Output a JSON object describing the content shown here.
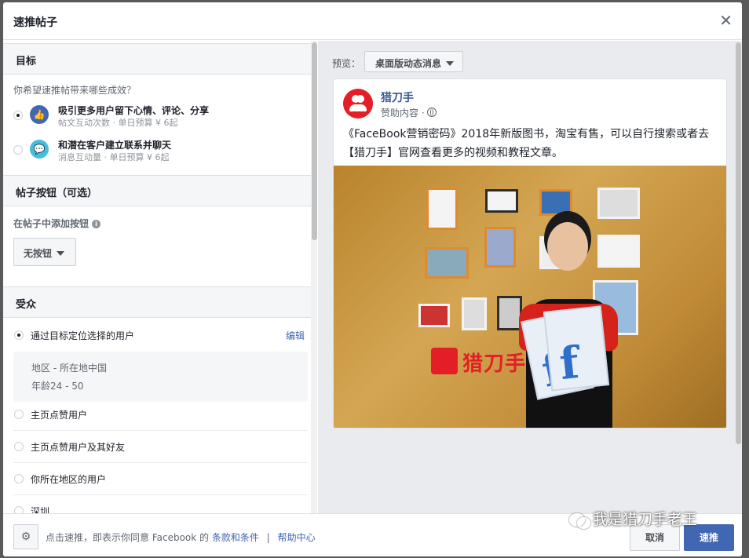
{
  "dialog": {
    "title": "速推帖子"
  },
  "sections": {
    "goal": "目标",
    "post_button": "帖子按钮（可选）",
    "audience": "受众"
  },
  "goal": {
    "question": "你希望速推帖带来哪些成效？",
    "options": [
      {
        "title": "吸引更多用户留下心情、评论、分享",
        "sub": "帖文互动次数 · 单日预算 ¥ 6起",
        "icon": "thumbs-up-icon",
        "color": "#4267b2",
        "selected": true
      },
      {
        "title": "和潜在客户建立联系并聊天",
        "sub": "消息互动量 · 单日预算 ¥ 6起",
        "icon": "chat-bubble-icon",
        "color": "#45bde0",
        "selected": false
      }
    ]
  },
  "post_button": {
    "label": "在帖子中添加按钮",
    "dropdown": "无按钮"
  },
  "audience": {
    "targeted": "通过目标定位选择的用户",
    "edit": "编辑",
    "region": "地区 - 所在地中国",
    "age": "年龄24 - 50",
    "options": [
      "主页点赞用户",
      "主页点赞用户及其好友",
      "你所在地区的用户",
      "深圳"
    ]
  },
  "preview": {
    "label": "预览：",
    "dropdown": "桌面版动态消息",
    "page_name": "猎刀手",
    "sponsored": "赞助内容 ·",
    "text": "《FaceBook营销密码》2018年新版图书，淘宝有售，可以自行搜索或者去【猎刀手】官网查看更多的视频和教程文章。",
    "photo_logo": "猎刀手"
  },
  "footer": {
    "terms_prefix": "点击速推，即表示你同意 Facebook 的",
    "terms_link": "条款和条件",
    "separator": "|",
    "help": "帮助中心",
    "cancel": "取消",
    "boost": "速推"
  },
  "watermark": "我是猎刀手老王"
}
